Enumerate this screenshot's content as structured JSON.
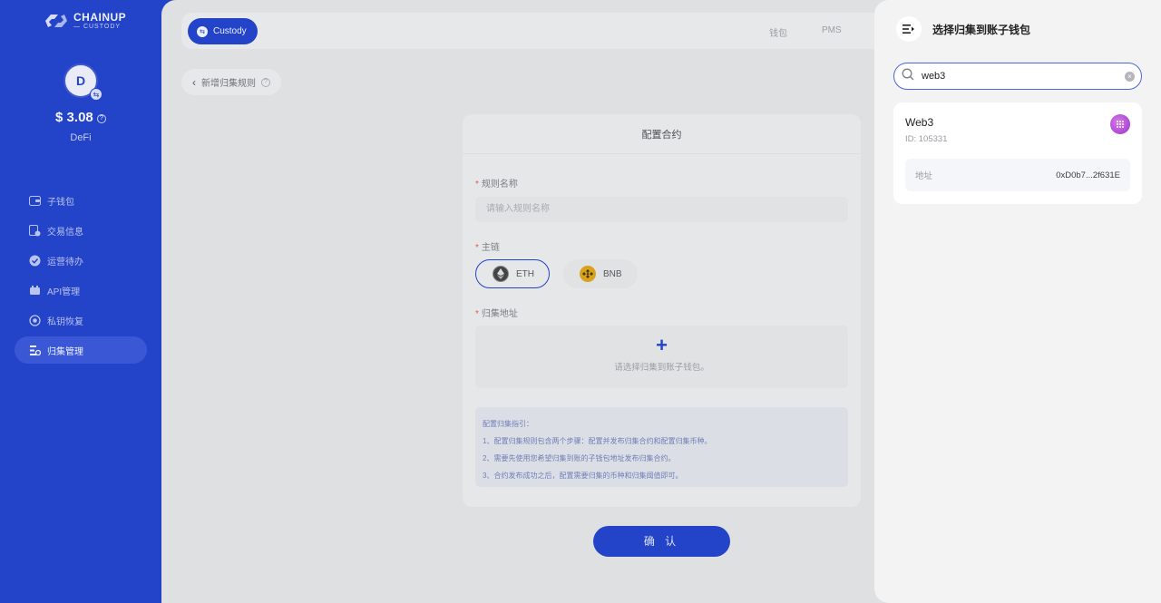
{
  "sidebar": {
    "logo": {
      "line1": "CHAINUP",
      "line2": "— CUSTODY"
    },
    "avatar_letter": "D",
    "balance": "$ 3.08",
    "account_name": "DeFi",
    "items": [
      {
        "label": "子钱包",
        "icon": "wallet-icon"
      },
      {
        "label": "交易信息",
        "icon": "transactions-icon"
      },
      {
        "label": "运营待办",
        "icon": "todo-check-icon"
      },
      {
        "label": "API管理",
        "icon": "api-icon"
      },
      {
        "label": "私钥恢复",
        "icon": "key-recovery-icon"
      },
      {
        "label": "归集管理",
        "icon": "collection-icon",
        "active": true
      }
    ]
  },
  "topbar": {
    "custody_label": "Custody",
    "nav": [
      "钱包",
      "PMS"
    ]
  },
  "breadcrumb": {
    "label": "新增归集规则"
  },
  "form": {
    "title": "配置合约",
    "rule_name_label": "规则名称",
    "rule_name_placeholder": "请输入规则名称",
    "chain_label": "主链",
    "chains": [
      {
        "name": "ETH",
        "selected": true
      },
      {
        "name": "BNB",
        "selected": false
      }
    ],
    "address_label": "归集地址",
    "address_hint": "请选择归集到账子钱包。",
    "guide": {
      "title": "配置归集指引：",
      "lines": [
        "1、配置归集规则包含两个步骤：配置并发布归集合约和配置归集币种。",
        "2、需要先使用您希望归集到账的子钱包地址发布归集合约。",
        "3、合约发布成功之后，配置需要归集的币种和归集阈值即可。"
      ]
    },
    "confirm_label": "确 认"
  },
  "drawer": {
    "title": "选择归集到账子钱包",
    "search_value": "web3",
    "result": {
      "name": "Web3",
      "id_text": "ID: 105331",
      "address_label": "地址",
      "address_value": "0xD0b7...2f631E"
    }
  },
  "colors": {
    "brand": "#2343c8",
    "drawer_bg": "#f3f3f4",
    "required": "#e05a5a"
  }
}
